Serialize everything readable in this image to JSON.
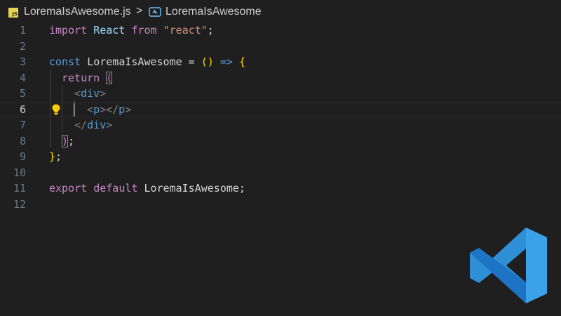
{
  "breadcrumb": {
    "file_icon_label": "JS",
    "file": "LoremaIsAwesome.js",
    "separator": ">",
    "symbol_icon": "symbol-variable-icon",
    "symbol": "LoremaIsAwesome"
  },
  "editor": {
    "active_line": 6,
    "lines": [
      {
        "number": "1",
        "tokens": [
          "import",
          " React ",
          "from",
          " ",
          "\"react\"",
          ";"
        ]
      },
      {
        "number": "2",
        "tokens": []
      },
      {
        "number": "3",
        "tokens": [
          "const",
          " ",
          "LoremaIsAwesome",
          " = ",
          "()",
          " ",
          "=>",
          " ",
          "{"
        ]
      },
      {
        "number": "4",
        "tokens": [
          "return",
          " ",
          "("
        ]
      },
      {
        "number": "5",
        "tokens": [
          "<",
          "div",
          ">"
        ]
      },
      {
        "number": "6",
        "tokens": [
          "<",
          "p",
          "></",
          "p",
          ">"
        ]
      },
      {
        "number": "7",
        "tokens": [
          "</",
          "div",
          ">"
        ]
      },
      {
        "number": "8",
        "tokens": [
          ")",
          ";"
        ]
      },
      {
        "number": "9",
        "tokens": [
          "}",
          ";"
        ]
      },
      {
        "number": "10",
        "tokens": []
      },
      {
        "number": "11",
        "tokens": [
          "export",
          " ",
          "default",
          " LoremaIsAwesome;"
        ]
      },
      {
        "number": "12",
        "tokens": []
      }
    ]
  },
  "icons": {
    "lightbulb": "lightbulb-icon",
    "logo": "vscode-logo-icon"
  },
  "colors": {
    "background": "#1f1f1f",
    "keyword_purple": "#c586c0",
    "keyword_blue": "#569cd6",
    "string": "#ce9178",
    "bracket_gold": "#ffd700",
    "bracket_pink": "#da70d6",
    "logo_blue": "#2f8fd6"
  }
}
